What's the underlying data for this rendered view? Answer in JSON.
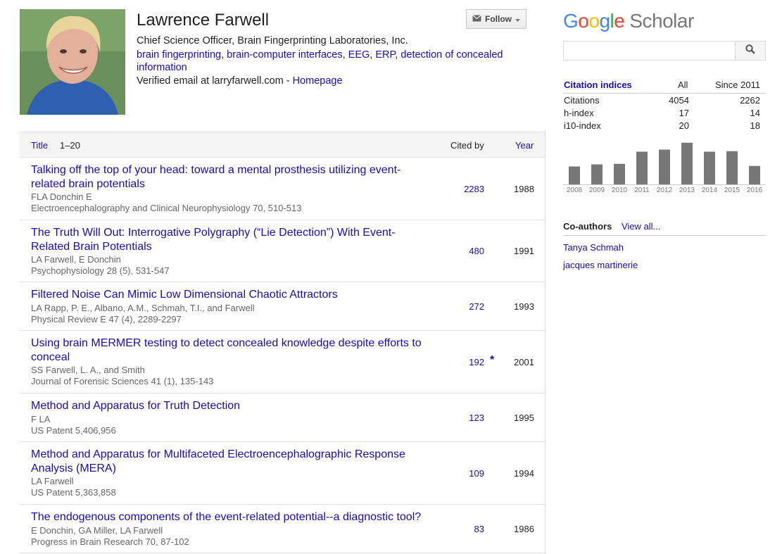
{
  "profile": {
    "name": "Lawrence Farwell",
    "affiliation": "Chief Science Officer, Brain Fingerprinting Laboratories, Inc.",
    "interests": [
      "brain fingerprinting",
      "brain-computer interfaces",
      "EEG",
      "ERP",
      "detection of concealed information"
    ],
    "verified_prefix": "Verified email at larryfarwell.com - ",
    "homepage_label": "Homepage",
    "follow_label": "Follow"
  },
  "table": {
    "header_title": "Title",
    "header_range": "1–20",
    "header_cited": "Cited by",
    "header_year": "Year",
    "rows": [
      {
        "title": "Talking off the top of your head: toward a mental prosthesis utilizing event-related brain potentials",
        "authors": "FLA Donchin E",
        "venue": "Electroencephalography and Clinical Neurophysiology 70, 510-513",
        "cited": "2283",
        "star": "",
        "year": "1988"
      },
      {
        "title": "The Truth Will Out: Interrogative Polygraphy (“Lie Detection”) With Event-Related Brain Potentials",
        "authors": "LA Farwell, E Donchin",
        "venue": "Psychophysiology 28 (5), 531-547",
        "cited": "480",
        "star": "",
        "year": "1991"
      },
      {
        "title": "Filtered Noise Can Mimic Low Dimensional Chaotic Attractors",
        "authors": "LA Rapp, P. E., Albano, A.M., Schmah, T.I., and Farwell",
        "venue": "Physical Review E 47 (4), 2289-2297",
        "cited": "272",
        "star": "",
        "year": "1993"
      },
      {
        "title": "Using brain MERMER testing to detect concealed knowledge despite efforts to conceal",
        "authors": "SS Farwell, L. A., and Smith",
        "venue": "Journal of Forensic Sciences 41 (1), 135-143",
        "cited": "192",
        "star": "*",
        "year": "2001"
      },
      {
        "title": "Method and Apparatus for Truth Detection",
        "authors": "F LA",
        "venue": "US Patent 5,406,956",
        "cited": "123",
        "star": "",
        "year": "1995"
      },
      {
        "title": "Method and Apparatus for Multifaceted Electroencephalographic Response Analysis (MERA)",
        "authors": "LA Farwell",
        "venue": "US Patent 5,363,858",
        "cited": "109",
        "star": "",
        "year": "1994"
      },
      {
        "title": "The endogenous components of the event-related potential--a diagnostic tool?",
        "authors": "E Donchin, GA Miller, LA Farwell",
        "venue": "Progress in Brain Research 70, 87-102",
        "cited": "83",
        "star": "",
        "year": "1986"
      }
    ]
  },
  "sidebar": {
    "logo_google": "Google",
    "logo_scholar": "Scholar",
    "logo_colors": [
      "#4285f4",
      "#ea4335",
      "#fbbc05",
      "#4285f4",
      "#34a853",
      "#ea4335"
    ],
    "search_placeholder": "",
    "citation_title": "Citation indices",
    "col_all": "All",
    "col_since": "Since 2011",
    "indices": [
      {
        "label": "Citations",
        "all": "4054",
        "since": "2262"
      },
      {
        "label": "h-index",
        "all": "17",
        "since": "14"
      },
      {
        "label": "i10-index",
        "all": "20",
        "since": "18"
      }
    ],
    "coauthors_title": "Co-authors",
    "view_all": "View all...",
    "coauthors": [
      "Tanya Schmah",
      "jacques martinerie"
    ]
  },
  "chart_data": {
    "type": "bar",
    "categories": [
      "2008",
      "2009",
      "2010",
      "2011",
      "2012",
      "2013",
      "2014",
      "2015",
      "2016"
    ],
    "values": [
      170,
      190,
      195,
      310,
      330,
      395,
      310,
      315,
      175
    ],
    "ylim": [
      0,
      400
    ],
    "color": "#777777",
    "grid": false
  }
}
